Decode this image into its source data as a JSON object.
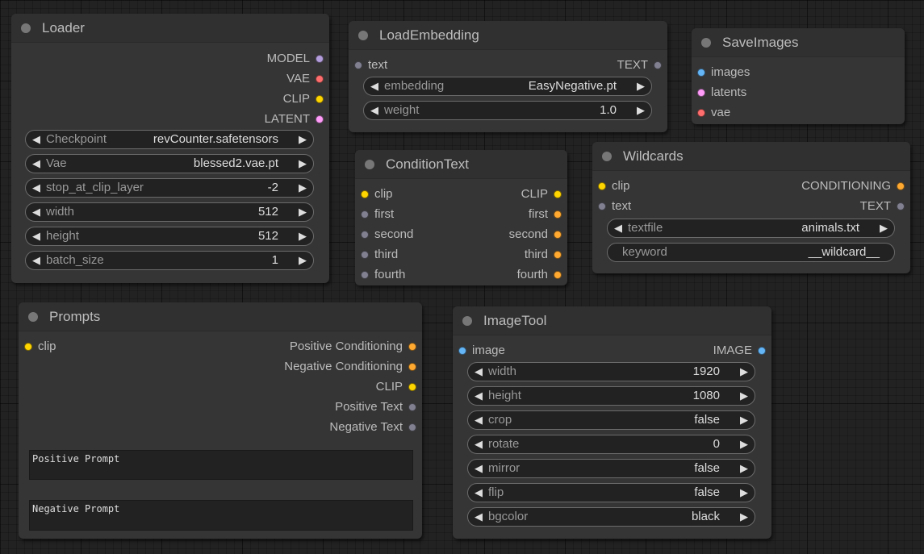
{
  "colors": {
    "MODEL": "#b39ddb",
    "VAE": "#ff6e6e",
    "CLIP": "#ffd500",
    "LATENT": "#ff9cf9",
    "IMAGE": "#64b5f6",
    "CONDITIONING": "#ffa931",
    "TEXT": "#808090",
    "string": "#808090"
  },
  "loader": {
    "title": "Loader",
    "outputs": [
      "MODEL",
      "VAE",
      "CLIP",
      "LATENT"
    ],
    "widgets": [
      {
        "label": "Checkpoint",
        "value": "revCounter.safetensors"
      },
      {
        "label": "Vae",
        "value": "blessed2.vae.pt"
      },
      {
        "label": "stop_at_clip_layer",
        "value": "-2"
      },
      {
        "label": "width",
        "value": "512"
      },
      {
        "label": "height",
        "value": "512"
      },
      {
        "label": "batch_size",
        "value": "1"
      }
    ]
  },
  "load_embedding": {
    "title": "LoadEmbedding",
    "input": "text",
    "output": "TEXT",
    "widgets": [
      {
        "label": "embedding",
        "value": "EasyNegative.pt"
      },
      {
        "label": "weight",
        "value": "1.0"
      }
    ]
  },
  "save_images": {
    "title": "SaveImages",
    "inputs": [
      "images",
      "latents",
      "vae"
    ]
  },
  "condition_text": {
    "title": "ConditionText",
    "inputs": [
      "clip",
      "first",
      "second",
      "third",
      "fourth"
    ],
    "outputs": [
      "CLIP",
      "first",
      "second",
      "third",
      "fourth"
    ]
  },
  "wildcards": {
    "title": "Wildcards",
    "inputs": [
      "clip",
      "text"
    ],
    "outputs": [
      "CONDITIONING",
      "TEXT"
    ],
    "widgets": [
      {
        "label": "textfile",
        "value": "animals.txt"
      },
      {
        "label": "keyword",
        "value": "__wildcard__"
      }
    ]
  },
  "prompts": {
    "title": "Prompts",
    "input": "clip",
    "outputs": [
      "Positive Conditioning",
      "Negative Conditioning",
      "CLIP",
      "Positive Text",
      "Negative Text"
    ],
    "positive_prompt": "Positive Prompt",
    "negative_prompt": "Negative Prompt"
  },
  "image_tool": {
    "title": "ImageTool",
    "input": "image",
    "output": "IMAGE",
    "widgets": [
      {
        "label": "width",
        "value": "1920"
      },
      {
        "label": "height",
        "value": "1080"
      },
      {
        "label": "crop",
        "value": "false"
      },
      {
        "label": "rotate",
        "value": "0"
      },
      {
        "label": "mirror",
        "value": "false"
      },
      {
        "label": "flip",
        "value": "false"
      },
      {
        "label": "bgcolor",
        "value": "black"
      }
    ]
  },
  "arrows": {
    "left": "◀",
    "right": "▶"
  }
}
